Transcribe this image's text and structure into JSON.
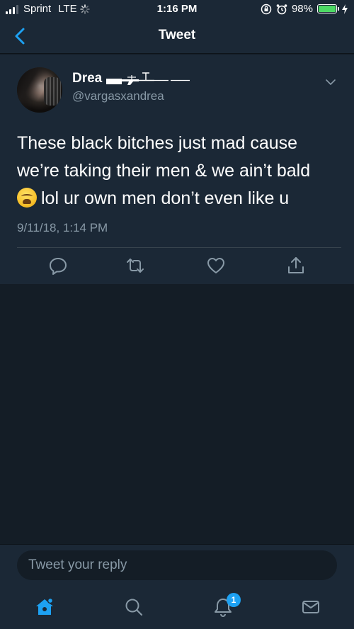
{
  "status_bar": {
    "carrier": "Sprint",
    "network": "LTE",
    "time": "1:16 PM",
    "battery_percent_label": "98%",
    "battery_level": 0.98,
    "icons": [
      "signal-bars-icon",
      "loading-icon",
      "rotation-lock-icon",
      "alarm-icon",
      "battery-icon",
      "charging-bolt-icon"
    ]
  },
  "nav": {
    "title": "Tweet",
    "back_icon": "chevron-left-icon"
  },
  "tweet": {
    "display_name": "Drea",
    "handle": "@vargasxandrea",
    "text_line1": "These black bitches just mad cause",
    "text_line2": "we’re taking their men & we ain’t bald",
    "text_line3": "lol ur own men don’t even like u",
    "emoji": "weary-face-emoji",
    "timestamp": "9/11/18, 1:14 PM",
    "actions": [
      "reply-icon",
      "retweet-icon",
      "like-icon",
      "share-icon"
    ]
  },
  "reply": {
    "placeholder": "Tweet your reply"
  },
  "tab_bar": {
    "tabs": [
      "home-icon",
      "search-icon",
      "notifications-icon",
      "messages-icon"
    ],
    "notification_count": "1"
  },
  "colors": {
    "background": "#141d26",
    "card": "#1b2836",
    "accent": "#1da1f2",
    "secondary_text": "#8899a6"
  }
}
